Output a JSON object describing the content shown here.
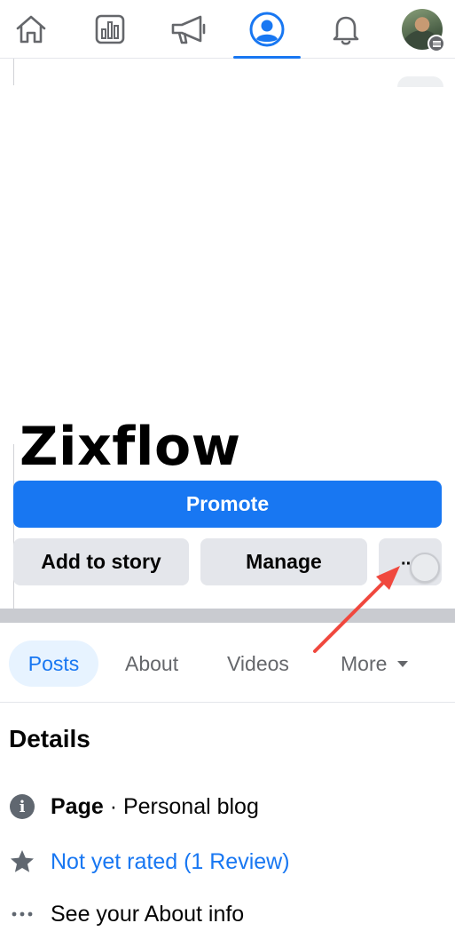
{
  "nav": {
    "items": [
      {
        "name": "home",
        "icon": "home-icon"
      },
      {
        "name": "insights",
        "icon": "insights-icon"
      },
      {
        "name": "ads",
        "icon": "megaphone-icon"
      },
      {
        "name": "profile",
        "icon": "profile-icon",
        "active": true
      },
      {
        "name": "notifications",
        "icon": "bell-icon"
      },
      {
        "name": "menu",
        "icon": "avatar"
      }
    ]
  },
  "page": {
    "name": "Zixflow"
  },
  "actions": {
    "promote_label": "Promote",
    "add_story_label": "Add to story",
    "manage_label": "Manage",
    "more_label": "···"
  },
  "tabs": {
    "posts": "Posts",
    "about": "About",
    "videos": "Videos",
    "more": "More"
  },
  "details": {
    "title": "Details",
    "category_bold": "Page",
    "category_rest": " · Personal blog",
    "rating": "Not yet rated (1 Review)",
    "about_link": "See your About info"
  },
  "colors": {
    "accent": "#1877f2",
    "annotation_arrow": "#f0483e"
  }
}
